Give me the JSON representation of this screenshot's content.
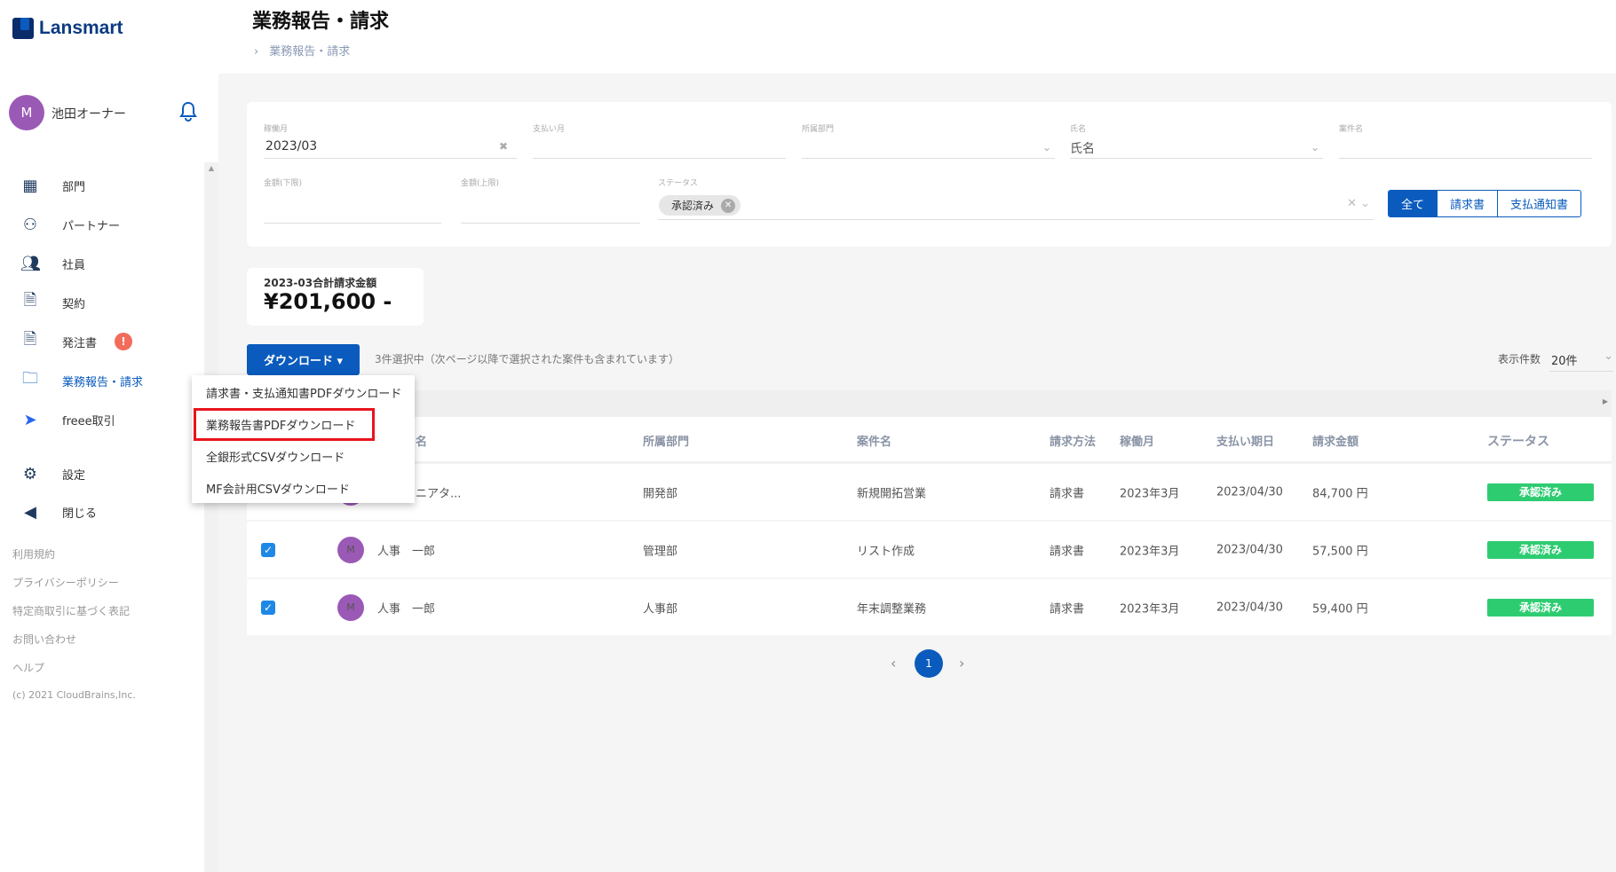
{
  "brand": "Lansmart",
  "user": {
    "initial": "M",
    "name": "池田オーナー"
  },
  "nav": [
    {
      "label": "部門",
      "icon": "building-icon"
    },
    {
      "label": "パートナー",
      "icon": "person-icon"
    },
    {
      "label": "社員",
      "icon": "people-icon"
    },
    {
      "label": "契約",
      "icon": "document-icon"
    },
    {
      "label": "発注書",
      "icon": "document-icon",
      "badge": "!"
    },
    {
      "label": "業務報告・請求",
      "icon": "folder-icon",
      "active": true
    },
    {
      "label": "freee取引",
      "icon": "freee-icon"
    },
    {
      "label": "設定",
      "icon": "gear-icon"
    },
    {
      "label": "閉じる",
      "icon": "back-circle-icon"
    }
  ],
  "footer": [
    "利用規約",
    "プライバシーポリシー",
    "特定商取引に基づく表記",
    "お問い合わせ",
    "ヘルプ",
    "(c) 2021 CloudBrains,Inc."
  ],
  "header": {
    "title": "業務報告・請求",
    "breadcrumb": "業務報告・請求"
  },
  "filters": {
    "work_month": {
      "label": "稼働月",
      "value": "2023/03"
    },
    "pay_month": {
      "label": "支払い月",
      "value": ""
    },
    "department": {
      "label": "所属部門",
      "value": ""
    },
    "name": {
      "label": "氏名",
      "value": "氏名"
    },
    "case": {
      "label": "案件名",
      "value": ""
    },
    "min_amount": {
      "label": "金額(下限)",
      "value": ""
    },
    "max_amount": {
      "label": "金額(上限)",
      "value": ""
    },
    "status": {
      "label": "ステータス",
      "chip": "承認済み"
    },
    "type_toggle": [
      "全て",
      "請求書",
      "支払通知書"
    ]
  },
  "summary": {
    "label": "2023-03合計請求金額",
    "amount": "¥201,600 -"
  },
  "toolbar": {
    "download": "ダウンロード ▾",
    "selection": "3件選択中（次ページ以降で選択された案件も含まれています）",
    "page_size_label": "表示件数",
    "page_size": "20件"
  },
  "download_menu": [
    "請求書・支払通知書PDFダウンロード",
    "業務報告書PDFダウンロード",
    "全銀形式CSVダウンロード",
    "MF会計用CSVダウンロード"
  ],
  "table": {
    "headers": [
      "名",
      "所属部門",
      "案件名",
      "請求方法",
      "稼働月",
      "支払い期日",
      "請求金額",
      "ステータス"
    ],
    "rows": [
      {
        "checked": false,
        "initial": "M",
        "name": "ニアタ...",
        "dept": "開発部",
        "case": "新規開拓営業",
        "method": "請求書",
        "month": "2023年3月",
        "due": "2023/04/30",
        "amount": "84,700 円",
        "status": "承認済み"
      },
      {
        "checked": true,
        "initial": "M",
        "name": "人事　一郎",
        "dept": "管理部",
        "case": "リスト作成",
        "method": "請求書",
        "month": "2023年3月",
        "due": "2023/04/30",
        "amount": "57,500 円",
        "status": "承認済み"
      },
      {
        "checked": true,
        "initial": "M",
        "name": "人事　一郎",
        "dept": "人事部",
        "case": "年末調整業務",
        "method": "請求書",
        "month": "2023年3月",
        "due": "2023/04/30",
        "amount": "59,400 円",
        "status": "承認済み"
      }
    ]
  },
  "pagination": {
    "current": "1"
  },
  "colors": {
    "primary": "#0a5bbd",
    "status_green": "#2ecc71",
    "avatar": "#9b59b6",
    "highlight_red": "#e8141c"
  }
}
